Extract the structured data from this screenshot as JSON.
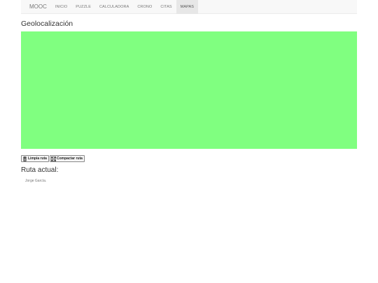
{
  "navbar": {
    "brand": "MOOC",
    "items": [
      {
        "label": "INICIO",
        "active": false
      },
      {
        "label": "PUZZLE",
        "active": false
      },
      {
        "label": "CALCULADORA",
        "active": false
      },
      {
        "label": "CRONO",
        "active": false
      },
      {
        "label": "CITAS",
        "active": false
      },
      {
        "label": "MAPAS",
        "active": true
      }
    ]
  },
  "page": {
    "title": "Geolocalización"
  },
  "map": {
    "color": "#80ff80"
  },
  "buttons": {
    "clear_route": {
      "label": "Limpia ruta",
      "icon": "trash-icon"
    },
    "compact_route": {
      "label": "Compactar ruta",
      "icon": "compress-icon"
    }
  },
  "route": {
    "heading": "Ruta actual:",
    "content": "Jorge García."
  }
}
